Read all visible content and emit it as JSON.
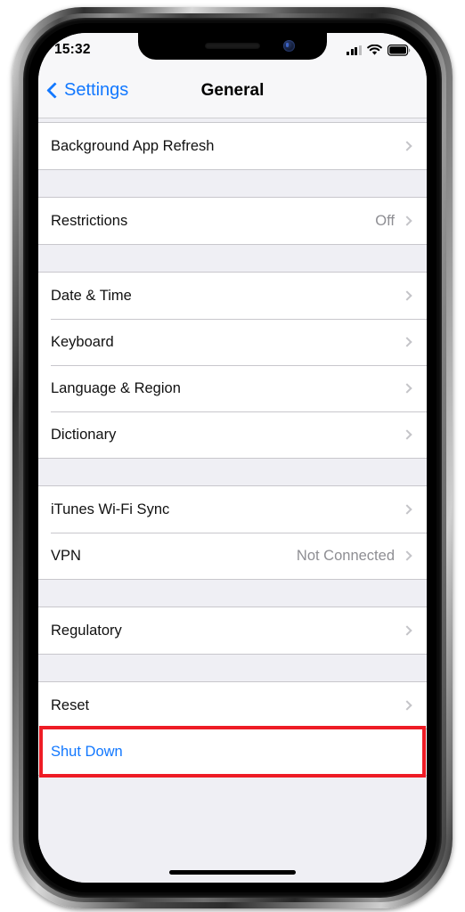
{
  "device": {
    "frame": "iphone-x",
    "home_indicator": true,
    "notch": true
  },
  "status_bar": {
    "time": "15:32",
    "signal_icon": "cellular-signal-icon",
    "signal_bars_filled": 3,
    "signal_bars_total": 4,
    "wifi_icon": "wifi-icon",
    "battery_icon": "battery-icon",
    "battery_full": true
  },
  "nav_bar": {
    "back_label": "Settings",
    "back_icon": "chevron-left-icon",
    "title": "General"
  },
  "colors": {
    "accent_blue": "#1278ff",
    "annotation_red": "#ee1c25",
    "group_background": "#efeff4",
    "row_background": "#ffffff",
    "separator": "#c8c7cc",
    "secondary_text": "#8e8e93"
  },
  "groups": [
    {
      "rows": [
        {
          "label": "Background App Refresh",
          "value": "",
          "accessory": "chevron-right-icon",
          "style": "default"
        }
      ]
    },
    {
      "rows": [
        {
          "label": "Restrictions",
          "value": "Off",
          "accessory": "chevron-right-icon",
          "style": "default"
        }
      ]
    },
    {
      "rows": [
        {
          "label": "Date & Time",
          "value": "",
          "accessory": "chevron-right-icon",
          "style": "default"
        },
        {
          "label": "Keyboard",
          "value": "",
          "accessory": "chevron-right-icon",
          "style": "default"
        },
        {
          "label": "Language & Region",
          "value": "",
          "accessory": "chevron-right-icon",
          "style": "default"
        },
        {
          "label": "Dictionary",
          "value": "",
          "accessory": "chevron-right-icon",
          "style": "default"
        }
      ]
    },
    {
      "rows": [
        {
          "label": "iTunes Wi-Fi Sync",
          "value": "",
          "accessory": "chevron-right-icon",
          "style": "default"
        },
        {
          "label": "VPN",
          "value": "Not Connected",
          "accessory": "chevron-right-icon",
          "style": "default"
        }
      ]
    },
    {
      "rows": [
        {
          "label": "Regulatory",
          "value": "",
          "accessory": "chevron-right-icon",
          "style": "default"
        }
      ]
    },
    {
      "rows": [
        {
          "label": "Reset",
          "value": "",
          "accessory": "chevron-right-icon",
          "style": "default"
        },
        {
          "label": "Shut Down",
          "value": "",
          "accessory": "none",
          "style": "link"
        }
      ]
    }
  ],
  "annotation": {
    "target_row_label": "Shut Down",
    "shape": "rectangle",
    "color": "#ee1c25"
  }
}
